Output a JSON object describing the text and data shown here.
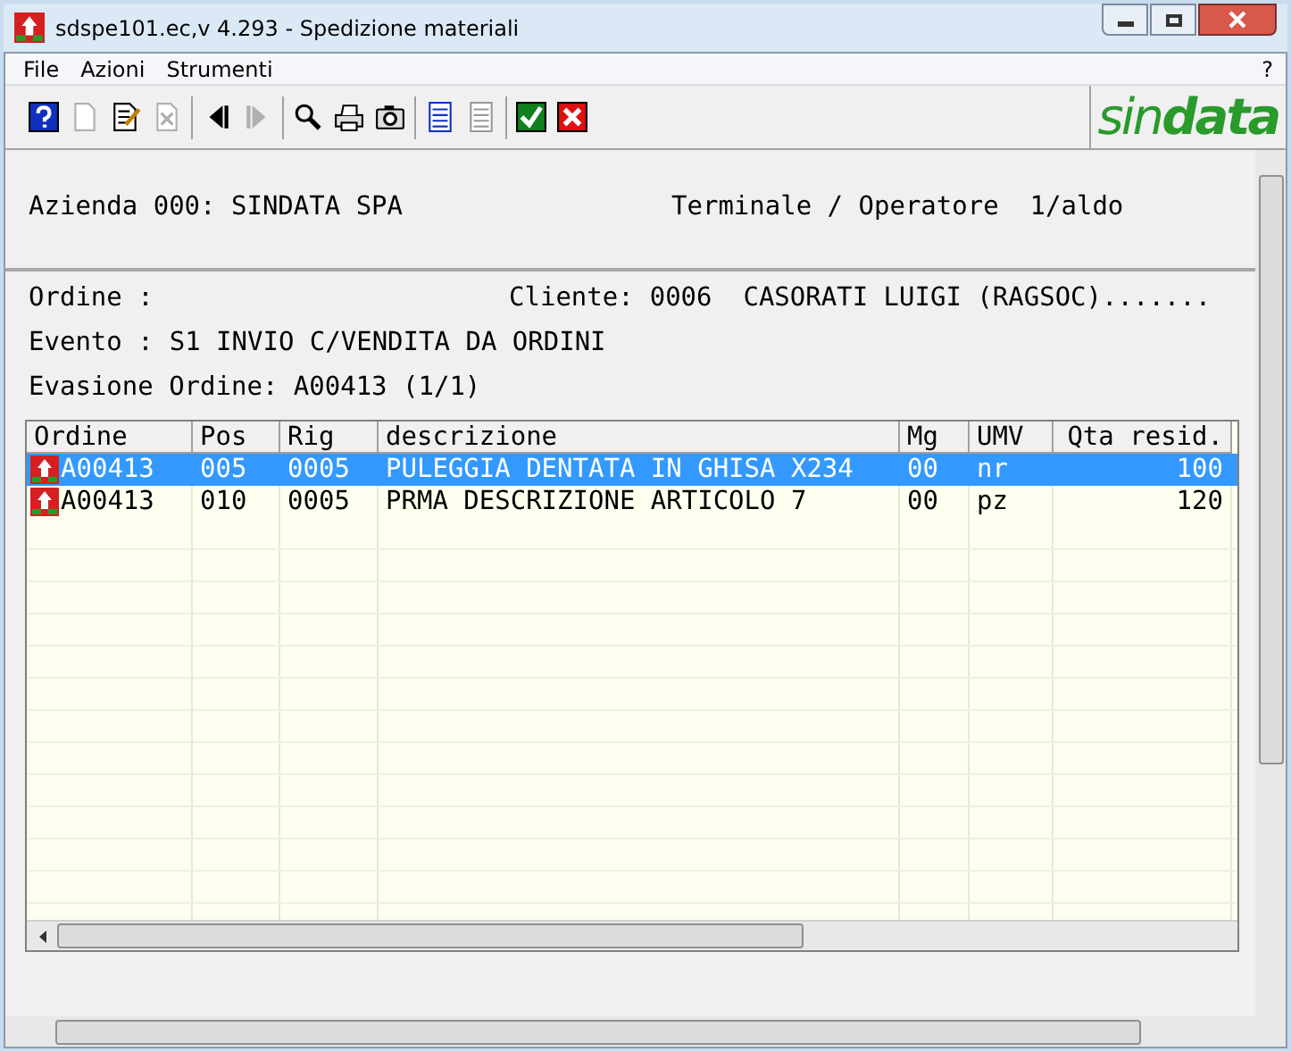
{
  "window": {
    "title": "sdspe101.ec,v 4.293 - Spedizione materiali"
  },
  "menu": [
    "File",
    "Azioni",
    "Strumenti"
  ],
  "menu_help": "?",
  "toolbar": [
    [
      {
        "kind": "help",
        "disabled": false
      },
      {
        "kind": "new",
        "disabled": true
      },
      {
        "kind": "edit",
        "disabled": false
      },
      {
        "kind": "delete",
        "disabled": true
      }
    ],
    [
      {
        "kind": "prev",
        "disabled": false
      },
      {
        "kind": "next",
        "disabled": true
      }
    ],
    [
      {
        "kind": "search",
        "disabled": false
      },
      {
        "kind": "print",
        "disabled": false
      },
      {
        "kind": "camera",
        "disabled": false
      }
    ],
    [
      {
        "kind": "list",
        "disabled": false
      },
      {
        "kind": "list",
        "disabled": true
      }
    ],
    [
      {
        "kind": "ok",
        "disabled": false
      },
      {
        "kind": "cancel",
        "disabled": false
      }
    ]
  ],
  "logo": {
    "part1": "sin",
    "part2": "data"
  },
  "header": {
    "azienda": "Azienda 000: SINDATA SPA",
    "terminale": "Terminale / Operatore  1/aldo"
  },
  "ordine_label": "Ordine :",
  "cliente_label": "Cliente:",
  "cliente_value": "0006  CASORATI LUIGI (RAGSOC).......",
  "evento_label": "Evento :",
  "evento_value": "S1 INVIO C/VENDITA DA ORDINI",
  "evasione": "Evasione Ordine: A00413 (1/1)",
  "table": {
    "columns": [
      "Ordine",
      "Pos",
      "Rig",
      "descrizione",
      "Mg",
      "UMV",
      "Qta resid."
    ],
    "rows": [
      {
        "selected": true,
        "cells": [
          "A00413",
          "005",
          "0005",
          "PULEGGIA DENTATA IN GHISA X234",
          "00",
          "nr",
          "100"
        ]
      },
      {
        "selected": false,
        "cells": [
          "A00413",
          "010",
          "0005",
          "PRMA DESCRIZIONE ARTICOLO 7",
          "00",
          "pz",
          "120"
        ]
      }
    ]
  }
}
